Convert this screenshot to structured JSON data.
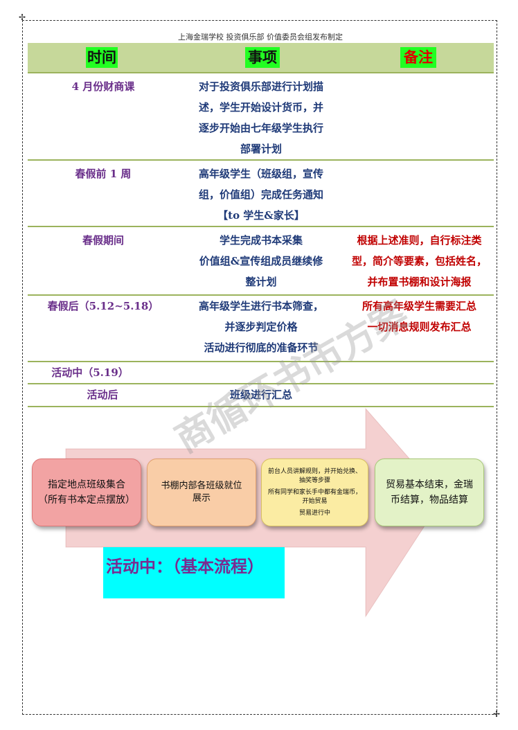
{
  "header_line": "上海金瑞学校  投资俱乐部  价值委员会组发布制定",
  "table": {
    "headers": [
      "时间",
      "事项",
      "备注"
    ],
    "rows": [
      {
        "time": "4 月份财商课",
        "items": [
          "对于投资俱乐部进行计划描",
          "述，学生开始设计货币，并",
          "逐步开始由七年级学生执行",
          "部署计划"
        ],
        "notes": []
      },
      {
        "time": "春假前 1 周",
        "items": [
          "高年级学生（班级组，宣传",
          "组，价值组）完成任务通知",
          "【to  学生&家长】"
        ],
        "notes": []
      },
      {
        "time": "春假期间",
        "items": [
          "学生完成书本采集",
          "价值组&宣传组成员继续修",
          "整计划"
        ],
        "notes": [
          "根据上述准则，自行标注类",
          "型，简介等要素，包括姓名，",
          "并布置书棚和设计海报"
        ]
      },
      {
        "time": "春假后（5.12~5.18）",
        "items": [
          "高年级学生进行书本筛查，",
          "并逐步判定价格",
          "活动进行彻底的准备环节"
        ],
        "notes": [
          "所有高年级学生需要汇总",
          "一切消息规则发布汇总"
        ]
      },
      {
        "time": "活动中（5.19）",
        "items": [],
        "notes": []
      },
      {
        "time": "活动后",
        "items": [
          "班级进行汇总"
        ],
        "notes": []
      }
    ]
  },
  "watermark": "商循环书市方案",
  "flow": {
    "box1": [
      "指定地点班级集合",
      "（所有书本定点摆放）"
    ],
    "box2": [
      "书棚内部各班级就位",
      "展示"
    ],
    "box3": [
      "前台人员讲解规则，并开始兑换、抽奖等步骤",
      "所有同学和家长手中都有金瑞币，开始贸易",
      "贸易进行中"
    ],
    "box4": [
      "贸易基本结束，金瑞",
      "币结算，物品结算"
    ]
  },
  "caption": "活动中：（基本流程）",
  "colors": {
    "header_bg": "#c6d89a",
    "header_cell": "#22ff22",
    "time": "#6a2f8a",
    "items": "#1f3a78",
    "notes": "#c00000",
    "caption_bg": "#00ffff"
  }
}
